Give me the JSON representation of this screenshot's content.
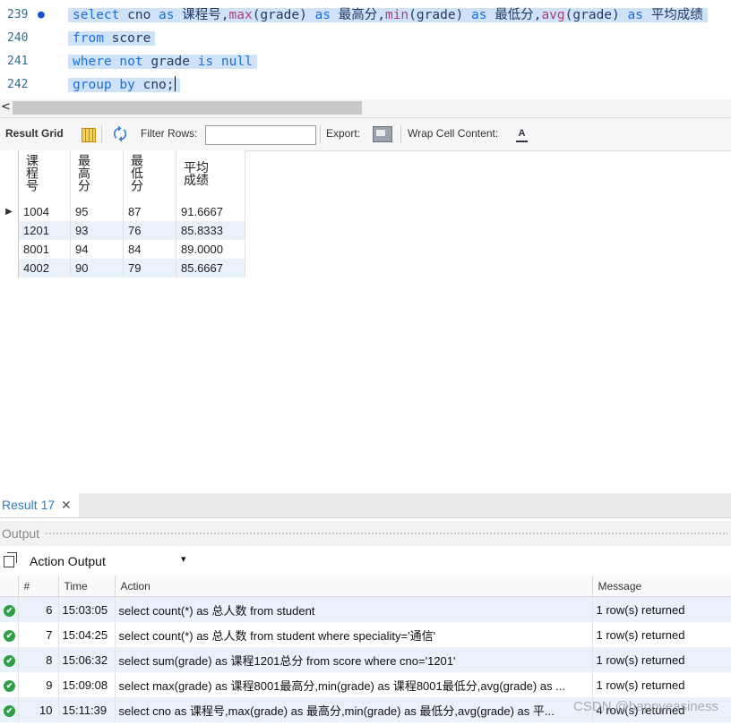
{
  "editor": {
    "lines": [
      {
        "number": "239",
        "marker": "●",
        "tokens": [
          {
            "t": "select",
            "c": "kw"
          },
          {
            "t": " cno ",
            "c": "tx"
          },
          {
            "t": "as",
            "c": "kw"
          },
          {
            "t": " 课程号,",
            "c": "tx"
          },
          {
            "t": "max",
            "c": "fn"
          },
          {
            "t": "(grade) ",
            "c": "tx"
          },
          {
            "t": "as",
            "c": "kw"
          },
          {
            "t": " 最高分,",
            "c": "tx"
          },
          {
            "t": "min",
            "c": "fn"
          },
          {
            "t": "(grade) ",
            "c": "tx"
          },
          {
            "t": "as",
            "c": "kw"
          },
          {
            "t": " 最低分,",
            "c": "tx"
          },
          {
            "t": "avg",
            "c": "fn"
          },
          {
            "t": "(grade) ",
            "c": "tx"
          },
          {
            "t": "as",
            "c": "kw"
          },
          {
            "t": " 平均成绩",
            "c": "tx"
          }
        ]
      },
      {
        "number": "240",
        "marker": "",
        "tokens": [
          {
            "t": "from",
            "c": "kw"
          },
          {
            "t": " score",
            "c": "tx"
          }
        ]
      },
      {
        "number": "241",
        "marker": "",
        "tokens": [
          {
            "t": "where",
            "c": "kw"
          },
          {
            "t": " ",
            "c": "tx"
          },
          {
            "t": "not",
            "c": "kw"
          },
          {
            "t": " grade ",
            "c": "tx"
          },
          {
            "t": "is",
            "c": "kw"
          },
          {
            "t": " ",
            "c": "tx"
          },
          {
            "t": "null",
            "c": "kw"
          }
        ]
      },
      {
        "number": "242",
        "marker": "",
        "tokens": [
          {
            "t": "group",
            "c": "kw"
          },
          {
            "t": " ",
            "c": "tx"
          },
          {
            "t": "by",
            "c": "kw"
          },
          {
            "t": " cno;",
            "c": "tx"
          }
        ]
      }
    ],
    "scroll_left_arrow": "<"
  },
  "toolbar": {
    "result_grid_label": "Result Grid",
    "filter_rows_label": "Filter Rows:",
    "filter_value": "",
    "export_label": "Export:",
    "wrap_label": "Wrap Cell Content:",
    "refresh_icon": "🗘"
  },
  "grid": {
    "columns": [
      "课程号",
      "最高分",
      "最低分",
      "平均成绩"
    ],
    "rows": [
      [
        "1004",
        "95",
        "87",
        "91.6667"
      ],
      [
        "1201",
        "93",
        "76",
        "85.8333"
      ],
      [
        "8001",
        "94",
        "84",
        "89.0000"
      ],
      [
        "4002",
        "90",
        "79",
        "85.6667"
      ]
    ],
    "current_row_indicator": "▶"
  },
  "result_tab": {
    "label": "Result 17",
    "close": "✕"
  },
  "output": {
    "header_label": "Output",
    "mode": "Action Output",
    "mode_arrow": "▾",
    "columns": [
      "",
      "#",
      "Time",
      "Action",
      "Message"
    ],
    "rows": [
      {
        "num": "6",
        "time": "15:03:05",
        "action": "select count(*) as 总人数 from student",
        "message": "1 row(s) returned"
      },
      {
        "num": "7",
        "time": "15:04:25",
        "action": "select count(*) as 总人数 from student where speciality='通信'",
        "message": "1 row(s) returned"
      },
      {
        "num": "8",
        "time": "15:06:32",
        "action": "select sum(grade) as 课程1201总分 from score where cno='1201'",
        "message": "1 row(s) returned"
      },
      {
        "num": "9",
        "time": "15:09:08",
        "action": "select max(grade) as 课程8001最高分,min(grade) as 课程8001最低分,avg(grade) as ...",
        "message": "1 row(s) returned"
      },
      {
        "num": "10",
        "time": "15:11:39",
        "action": "select cno as 课程号,max(grade) as 最高分,min(grade) as 最低分,avg(grade) as 平...",
        "message": "4 row(s) returned"
      }
    ],
    "status_icon": "✔"
  },
  "watermark": "CSDN @happyeasiness",
  "colors": {
    "keyword": "#1a6fe0",
    "function": "#a9407a",
    "selection": "#cfe2f7",
    "accent": "#2d79c7",
    "success": "#2ea043"
  }
}
